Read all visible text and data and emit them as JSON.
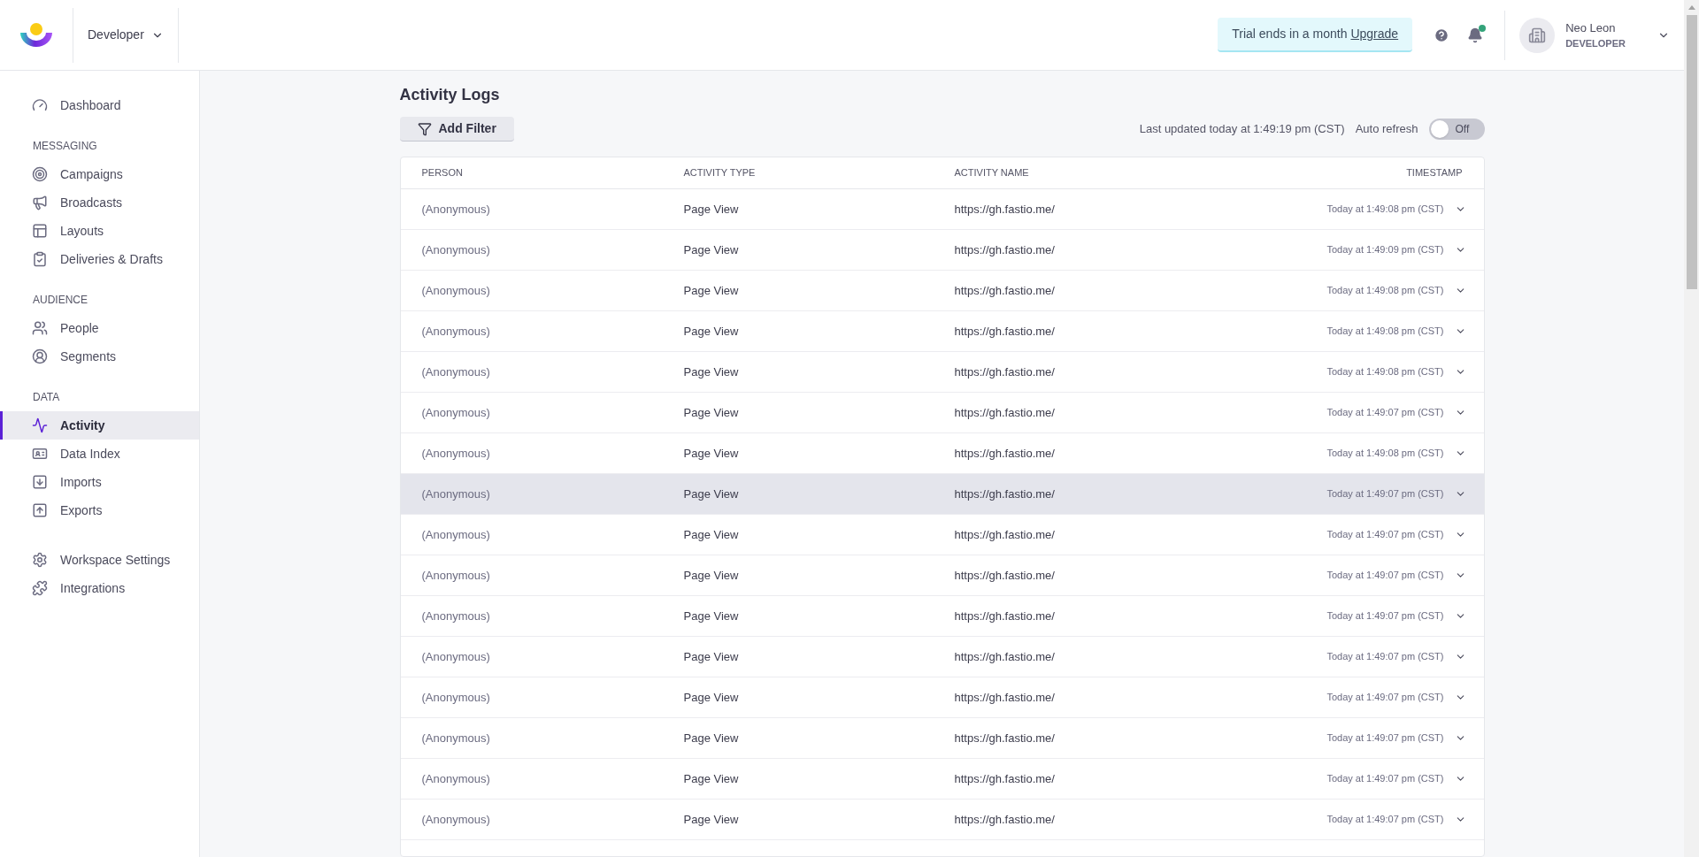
{
  "header": {
    "workspace": "Developer",
    "trial": {
      "text": "Trial ends in a month",
      "link": "Upgrade"
    },
    "notifications": {
      "unread": true
    },
    "user": {
      "name": "Neo Leon",
      "role": "DEVELOPER"
    }
  },
  "sidebar": {
    "sections": [
      {
        "items": [
          {
            "label": "Dashboard",
            "selected": false
          }
        ]
      },
      {
        "heading": "MESSAGING",
        "items": [
          {
            "label": "Campaigns",
            "selected": false
          },
          {
            "label": "Broadcasts",
            "selected": false
          },
          {
            "label": "Layouts",
            "selected": false
          },
          {
            "label": "Deliveries & Drafts",
            "selected": false
          }
        ]
      },
      {
        "heading": "AUDIENCE",
        "items": [
          {
            "label": "People",
            "selected": false
          },
          {
            "label": "Segments",
            "selected": false
          }
        ]
      },
      {
        "heading": "DATA",
        "items": [
          {
            "label": "Activity",
            "selected": true
          },
          {
            "label": "Data Index",
            "selected": false
          },
          {
            "label": "Imports",
            "selected": false
          },
          {
            "label": "Exports",
            "selected": false
          }
        ]
      },
      {
        "items": [
          {
            "label": "Workspace Settings",
            "selected": false
          },
          {
            "label": "Integrations",
            "selected": false
          }
        ]
      }
    ]
  },
  "page": {
    "title": "Activity Logs",
    "filter_button": "Add Filter",
    "last_updated": "Last updated today at 1:49:19 pm (CST)",
    "auto_refresh": {
      "label": "Auto refresh",
      "on": false,
      "state_text": "Off"
    }
  },
  "table": {
    "columns": [
      "PERSON",
      "ACTIVITY TYPE",
      "ACTIVITY NAME",
      "TIMESTAMP"
    ],
    "rows": [
      {
        "person": "(Anonymous)",
        "type": "Page View",
        "name": "https://gh.fastio.me/",
        "timestamp": "Today at 1:49:08 pm (CST)",
        "selected": false
      },
      {
        "person": "(Anonymous)",
        "type": "Page View",
        "name": "https://gh.fastio.me/",
        "timestamp": "Today at 1:49:09 pm (CST)",
        "selected": false
      },
      {
        "person": "(Anonymous)",
        "type": "Page View",
        "name": "https://gh.fastio.me/",
        "timestamp": "Today at 1:49:08 pm (CST)",
        "selected": false
      },
      {
        "person": "(Anonymous)",
        "type": "Page View",
        "name": "https://gh.fastio.me/",
        "timestamp": "Today at 1:49:08 pm (CST)",
        "selected": false
      },
      {
        "person": "(Anonymous)",
        "type": "Page View",
        "name": "https://gh.fastio.me/",
        "timestamp": "Today at 1:49:08 pm (CST)",
        "selected": false
      },
      {
        "person": "(Anonymous)",
        "type": "Page View",
        "name": "https://gh.fastio.me/",
        "timestamp": "Today at 1:49:07 pm (CST)",
        "selected": false
      },
      {
        "person": "(Anonymous)",
        "type": "Page View",
        "name": "https://gh.fastio.me/",
        "timestamp": "Today at 1:49:08 pm (CST)",
        "selected": false
      },
      {
        "person": "(Anonymous)",
        "type": "Page View",
        "name": "https://gh.fastio.me/",
        "timestamp": "Today at 1:49:07 pm (CST)",
        "selected": true
      },
      {
        "person": "(Anonymous)",
        "type": "Page View",
        "name": "https://gh.fastio.me/",
        "timestamp": "Today at 1:49:07 pm (CST)",
        "selected": false
      },
      {
        "person": "(Anonymous)",
        "type": "Page View",
        "name": "https://gh.fastio.me/",
        "timestamp": "Today at 1:49:07 pm (CST)",
        "selected": false
      },
      {
        "person": "(Anonymous)",
        "type": "Page View",
        "name": "https://gh.fastio.me/",
        "timestamp": "Today at 1:49:07 pm (CST)",
        "selected": false
      },
      {
        "person": "(Anonymous)",
        "type": "Page View",
        "name": "https://gh.fastio.me/",
        "timestamp": "Today at 1:49:07 pm (CST)",
        "selected": false
      },
      {
        "person": "(Anonymous)",
        "type": "Page View",
        "name": "https://gh.fastio.me/",
        "timestamp": "Today at 1:49:07 pm (CST)",
        "selected": false
      },
      {
        "person": "(Anonymous)",
        "type": "Page View",
        "name": "https://gh.fastio.me/",
        "timestamp": "Today at 1:49:07 pm (CST)",
        "selected": false
      },
      {
        "person": "(Anonymous)",
        "type": "Page View",
        "name": "https://gh.fastio.me/",
        "timestamp": "Today at 1:49:07 pm (CST)",
        "selected": false
      },
      {
        "person": "(Anonymous)",
        "type": "Page View",
        "name": "https://gh.fastio.me/",
        "timestamp": "Today at 1:49:07 pm (CST)",
        "selected": false
      }
    ]
  }
}
